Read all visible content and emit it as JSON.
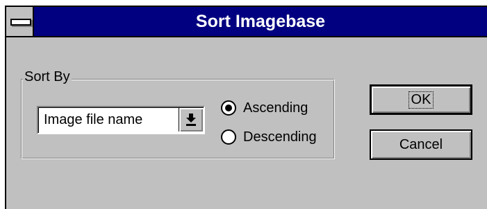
{
  "dialog": {
    "title": "Sort Imagebase",
    "system_menu_icon": "system-menu-icon"
  },
  "sort_by": {
    "label": "Sort By",
    "field": {
      "selected": "Image file name",
      "arrow_icon": "dropdown-arrow-icon"
    },
    "order": {
      "options": [
        {
          "label": "Ascending",
          "checked": true
        },
        {
          "label": "Descending",
          "checked": false
        }
      ]
    }
  },
  "buttons": {
    "ok": "OK",
    "cancel": "Cancel"
  },
  "colors": {
    "title_bar": "#000080",
    "face": "#c0c0c0",
    "shadow": "#808080",
    "highlight": "#ffffff"
  }
}
